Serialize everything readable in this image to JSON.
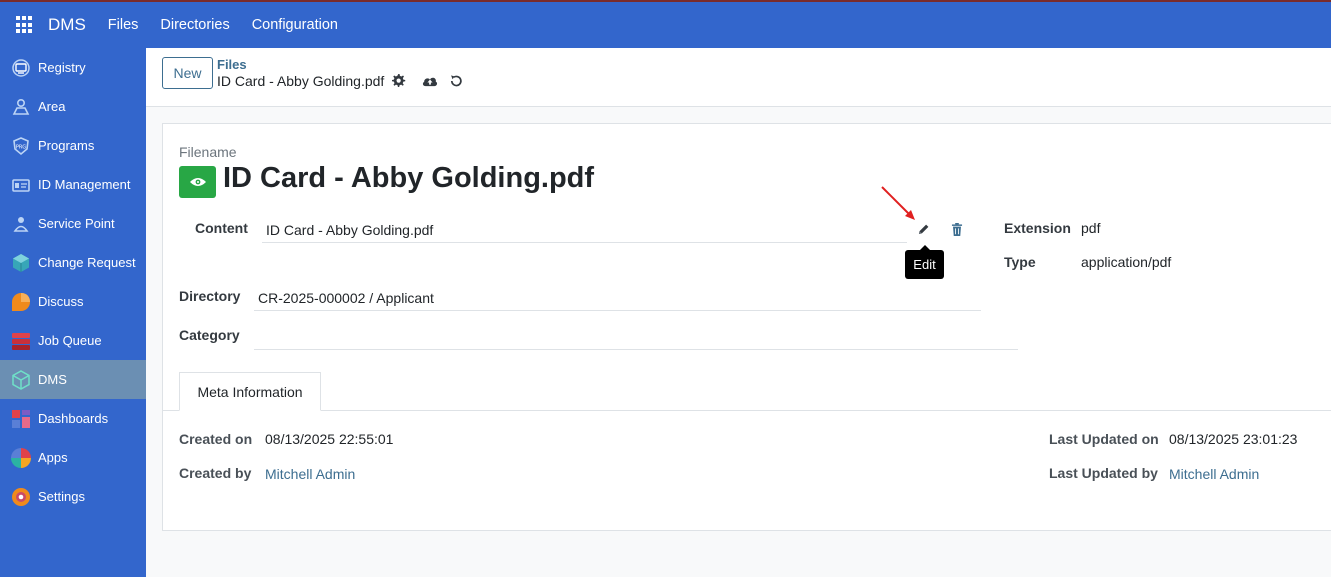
{
  "navbar": {
    "brand": "DMS",
    "menu": [
      "Files",
      "Directories",
      "Configuration"
    ]
  },
  "sidebar": {
    "items": [
      {
        "label": "Registry",
        "icon": "registry-icon"
      },
      {
        "label": "Area",
        "icon": "area-icon"
      },
      {
        "label": "Programs",
        "icon": "programs-icon"
      },
      {
        "label": "ID Management",
        "icon": "id-management-icon"
      },
      {
        "label": "Service Point",
        "icon": "service-point-icon"
      },
      {
        "label": "Change Request",
        "icon": "change-request-icon"
      },
      {
        "label": "Discuss",
        "icon": "discuss-icon"
      },
      {
        "label": "Job Queue",
        "icon": "job-queue-icon"
      },
      {
        "label": "DMS",
        "icon": "dms-icon",
        "active": true
      },
      {
        "label": "Dashboards",
        "icon": "dashboards-icon"
      },
      {
        "label": "Apps",
        "icon": "apps-icon"
      },
      {
        "label": "Settings",
        "icon": "settings-icon"
      }
    ]
  },
  "control": {
    "new_label": "New",
    "breadcrumb_parent": "Files",
    "breadcrumb_current": "ID Card - Abby Golding.pdf"
  },
  "form": {
    "filename_label": "Filename",
    "filename": "ID Card - Abby Golding.pdf",
    "content_label": "Content",
    "content_value": "ID Card - Abby Golding.pdf",
    "edit_tooltip": "Edit",
    "extension_label": "Extension",
    "extension_value": "pdf",
    "type_label": "Type",
    "type_value": "application/pdf",
    "directory_label": "Directory",
    "directory_value": "CR-2025-000002 / Applicant",
    "category_label": "Category",
    "category_value": "",
    "tab_label": "Meta Information",
    "created_on_label": "Created on",
    "created_on_value": "08/13/2025 22:55:01",
    "created_by_label": "Created by",
    "created_by_value": "Mitchell Admin",
    "updated_on_label": "Last Updated on",
    "updated_on_value": "08/13/2025 23:01:23",
    "updated_by_label": "Last Updated by",
    "updated_by_value": "Mitchell Admin"
  },
  "colors": {
    "navbar": "#3366cc",
    "sidebar_active": "#6b8fb3",
    "link": "#3d6e90",
    "success": "#28a745",
    "annotation_arrow": "#e02020"
  }
}
